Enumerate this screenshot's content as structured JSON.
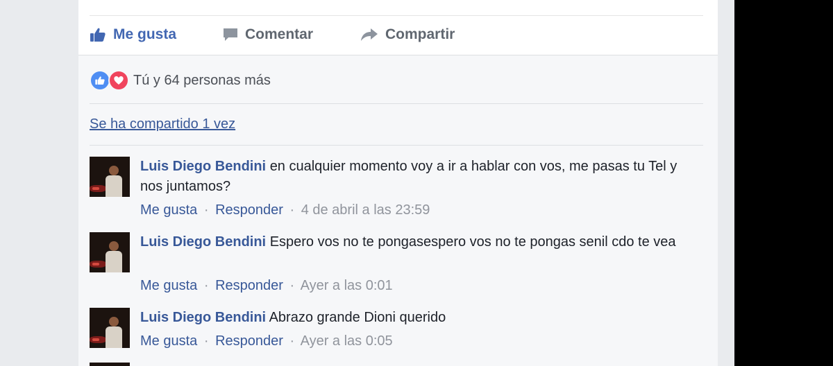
{
  "actions": {
    "like_label": "Me gusta",
    "comment_label": "Comentar",
    "share_label": "Compartir"
  },
  "reactions": {
    "summary": "Tú y 64 personas más",
    "icons": [
      "like-icon",
      "love-icon"
    ],
    "colors": {
      "like": "#4f8ef3",
      "love": "#f0445d"
    }
  },
  "shares": {
    "label": "Se ha compartido 1 vez"
  },
  "comments": [
    {
      "author": "Luis Diego Bendini",
      "text": "en cualquier momento voy a ir a hablar con vos, me pasas tu Tel y nos juntamos?",
      "like_label": "Me gusta",
      "reply_label": "Responder",
      "separator": "·",
      "timestamp": "4 de abril a las 23:59"
    },
    {
      "author": "Luis Diego Bendini",
      "text": "Espero vos no te pongasespero vos no te pongas senil cdo te vea",
      "like_label": "Me gusta",
      "reply_label": "Responder",
      "separator": "·",
      "timestamp": "Ayer a las 0:01"
    },
    {
      "author": "Luis Diego Bendini",
      "text": "Abrazo grande Dioni querido",
      "like_label": "Me gusta",
      "reply_label": "Responder",
      "separator": "·",
      "timestamp": "Ayer a las 0:05"
    }
  ],
  "colors": {
    "link": "#385898",
    "accent": "#4267b2",
    "meta": "#90949c"
  }
}
